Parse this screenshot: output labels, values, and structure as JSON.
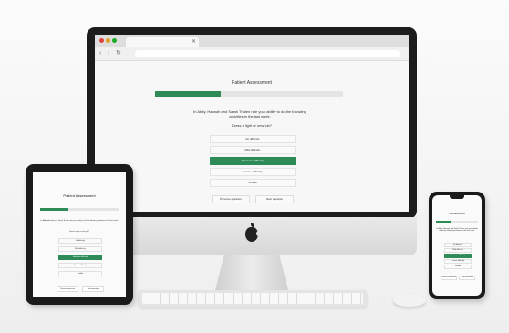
{
  "page_title": "Patient Assessment",
  "progress_fraction": 0.35,
  "question_intro": "In Abby, Hannah and Sarah Thalen rate your ability to do the following activities in the last week:",
  "question": "Dress a light or new job?",
  "options": [
    "No difficulty",
    "Mild difficulty",
    "Moderate difficulty",
    "Severe difficulty",
    "Unable"
  ],
  "selected_index": 2,
  "buttons": {
    "previous": "Previous question",
    "next": "Next question"
  },
  "colors": {
    "accent": "#2e8b57",
    "bezel": "#1c1c1c",
    "page_bg": "#f7f7f7"
  },
  "icons": {
    "back": "back-arrow-icon",
    "forward": "forward-arrow-icon",
    "reload": "reload-icon",
    "logo": "apple-logo-icon"
  }
}
